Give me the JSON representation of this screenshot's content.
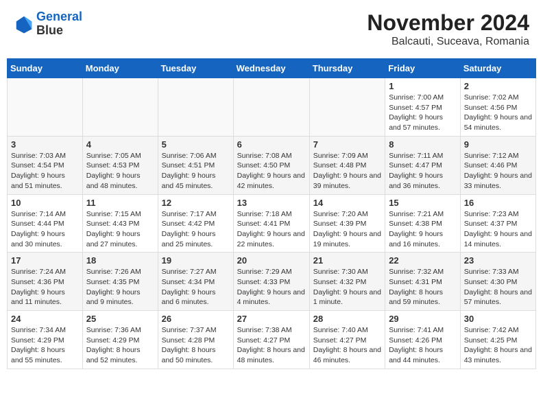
{
  "header": {
    "logo_line1": "General",
    "logo_line2": "Blue",
    "month_year": "November 2024",
    "location": "Balcauti, Suceava, Romania"
  },
  "weekdays": [
    "Sunday",
    "Monday",
    "Tuesday",
    "Wednesday",
    "Thursday",
    "Friday",
    "Saturday"
  ],
  "weeks": [
    [
      {
        "day": "",
        "info": ""
      },
      {
        "day": "",
        "info": ""
      },
      {
        "day": "",
        "info": ""
      },
      {
        "day": "",
        "info": ""
      },
      {
        "day": "",
        "info": ""
      },
      {
        "day": "1",
        "info": "Sunrise: 7:00 AM\nSunset: 4:57 PM\nDaylight: 9 hours and 57 minutes."
      },
      {
        "day": "2",
        "info": "Sunrise: 7:02 AM\nSunset: 4:56 PM\nDaylight: 9 hours and 54 minutes."
      }
    ],
    [
      {
        "day": "3",
        "info": "Sunrise: 7:03 AM\nSunset: 4:54 PM\nDaylight: 9 hours and 51 minutes."
      },
      {
        "day": "4",
        "info": "Sunrise: 7:05 AM\nSunset: 4:53 PM\nDaylight: 9 hours and 48 minutes."
      },
      {
        "day": "5",
        "info": "Sunrise: 7:06 AM\nSunset: 4:51 PM\nDaylight: 9 hours and 45 minutes."
      },
      {
        "day": "6",
        "info": "Sunrise: 7:08 AM\nSunset: 4:50 PM\nDaylight: 9 hours and 42 minutes."
      },
      {
        "day": "7",
        "info": "Sunrise: 7:09 AM\nSunset: 4:48 PM\nDaylight: 9 hours and 39 minutes."
      },
      {
        "day": "8",
        "info": "Sunrise: 7:11 AM\nSunset: 4:47 PM\nDaylight: 9 hours and 36 minutes."
      },
      {
        "day": "9",
        "info": "Sunrise: 7:12 AM\nSunset: 4:46 PM\nDaylight: 9 hours and 33 minutes."
      }
    ],
    [
      {
        "day": "10",
        "info": "Sunrise: 7:14 AM\nSunset: 4:44 PM\nDaylight: 9 hours and 30 minutes."
      },
      {
        "day": "11",
        "info": "Sunrise: 7:15 AM\nSunset: 4:43 PM\nDaylight: 9 hours and 27 minutes."
      },
      {
        "day": "12",
        "info": "Sunrise: 7:17 AM\nSunset: 4:42 PM\nDaylight: 9 hours and 25 minutes."
      },
      {
        "day": "13",
        "info": "Sunrise: 7:18 AM\nSunset: 4:41 PM\nDaylight: 9 hours and 22 minutes."
      },
      {
        "day": "14",
        "info": "Sunrise: 7:20 AM\nSunset: 4:39 PM\nDaylight: 9 hours and 19 minutes."
      },
      {
        "day": "15",
        "info": "Sunrise: 7:21 AM\nSunset: 4:38 PM\nDaylight: 9 hours and 16 minutes."
      },
      {
        "day": "16",
        "info": "Sunrise: 7:23 AM\nSunset: 4:37 PM\nDaylight: 9 hours and 14 minutes."
      }
    ],
    [
      {
        "day": "17",
        "info": "Sunrise: 7:24 AM\nSunset: 4:36 PM\nDaylight: 9 hours and 11 minutes."
      },
      {
        "day": "18",
        "info": "Sunrise: 7:26 AM\nSunset: 4:35 PM\nDaylight: 9 hours and 9 minutes."
      },
      {
        "day": "19",
        "info": "Sunrise: 7:27 AM\nSunset: 4:34 PM\nDaylight: 9 hours and 6 minutes."
      },
      {
        "day": "20",
        "info": "Sunrise: 7:29 AM\nSunset: 4:33 PM\nDaylight: 9 hours and 4 minutes."
      },
      {
        "day": "21",
        "info": "Sunrise: 7:30 AM\nSunset: 4:32 PM\nDaylight: 9 hours and 1 minute."
      },
      {
        "day": "22",
        "info": "Sunrise: 7:32 AM\nSunset: 4:31 PM\nDaylight: 8 hours and 59 minutes."
      },
      {
        "day": "23",
        "info": "Sunrise: 7:33 AM\nSunset: 4:30 PM\nDaylight: 8 hours and 57 minutes."
      }
    ],
    [
      {
        "day": "24",
        "info": "Sunrise: 7:34 AM\nSunset: 4:29 PM\nDaylight: 8 hours and 55 minutes."
      },
      {
        "day": "25",
        "info": "Sunrise: 7:36 AM\nSunset: 4:29 PM\nDaylight: 8 hours and 52 minutes."
      },
      {
        "day": "26",
        "info": "Sunrise: 7:37 AM\nSunset: 4:28 PM\nDaylight: 8 hours and 50 minutes."
      },
      {
        "day": "27",
        "info": "Sunrise: 7:38 AM\nSunset: 4:27 PM\nDaylight: 8 hours and 48 minutes."
      },
      {
        "day": "28",
        "info": "Sunrise: 7:40 AM\nSunset: 4:27 PM\nDaylight: 8 hours and 46 minutes."
      },
      {
        "day": "29",
        "info": "Sunrise: 7:41 AM\nSunset: 4:26 PM\nDaylight: 8 hours and 44 minutes."
      },
      {
        "day": "30",
        "info": "Sunrise: 7:42 AM\nSunset: 4:25 PM\nDaylight: 8 hours and 43 minutes."
      }
    ]
  ]
}
